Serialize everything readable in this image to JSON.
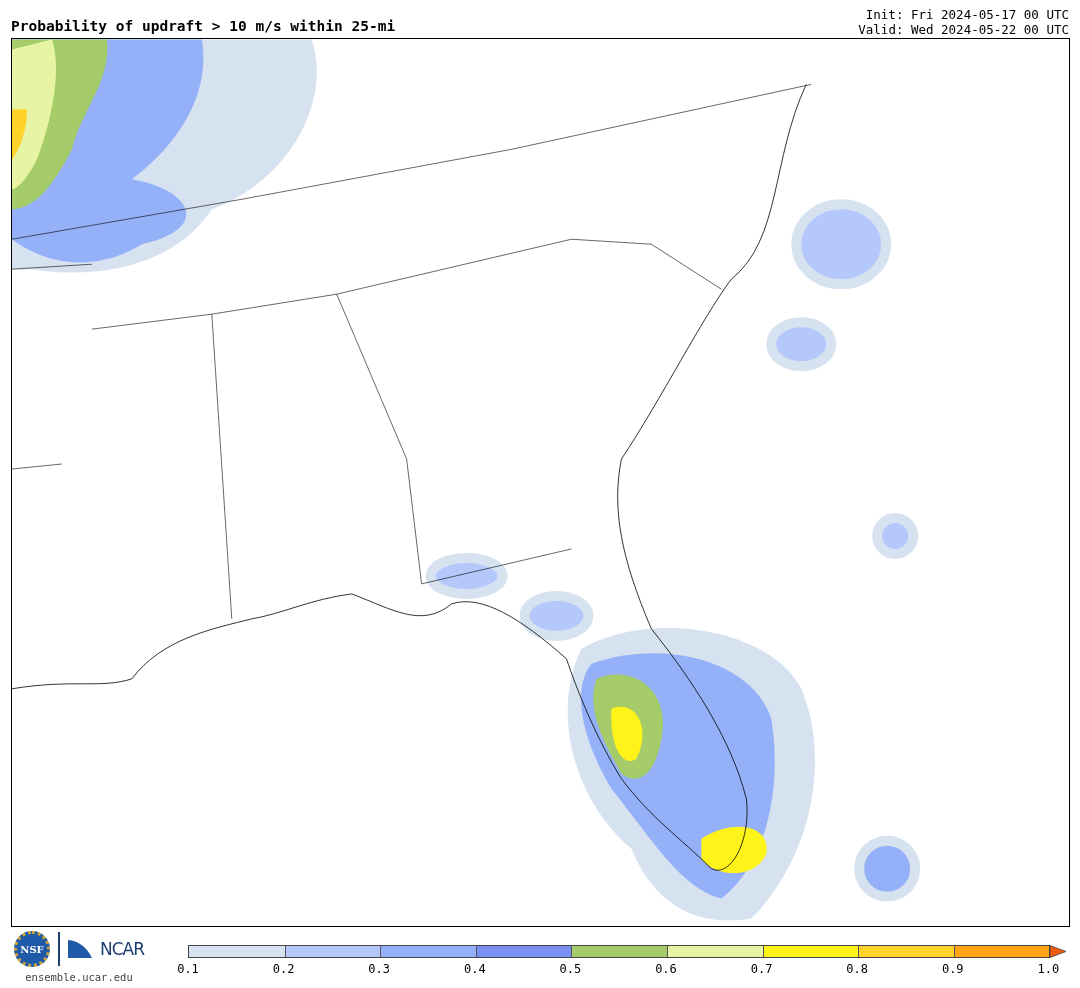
{
  "header": {
    "title": "Probability of updraft > 10 m/s within 25-mi",
    "init": "Init: Fri 2024-05-17 00 UTC",
    "valid": "Valid: Wed 2024-05-22 00 UTC"
  },
  "footer": {
    "logo_text": "NSF",
    "brand": "NCAR",
    "url": "ensemble.ucar.edu"
  },
  "colorbar": {
    "bins": [
      {
        "kind": "segment",
        "color": "#d6e2ef"
      },
      {
        "kind": "segment",
        "color": "#b5c8fb"
      },
      {
        "kind": "segment",
        "color": "#94b0f8"
      },
      {
        "kind": "segment",
        "color": "#7b90f3"
      },
      {
        "kind": "segment",
        "color": "#a6cc6a"
      },
      {
        "kind": "segment",
        "color": "#e6f4a3"
      },
      {
        "kind": "segment",
        "color": "#fff41a"
      },
      {
        "kind": "segment",
        "color": "#ffd32a"
      },
      {
        "kind": "segment",
        "color": "#ffa413"
      },
      {
        "kind": "arrow",
        "color": "#f25a12"
      }
    ],
    "ticks": [
      "0.1",
      "0.2",
      "0.3",
      "0.4",
      "0.5",
      "0.6",
      "0.7",
      "0.8",
      "0.9",
      "1.0"
    ]
  }
}
